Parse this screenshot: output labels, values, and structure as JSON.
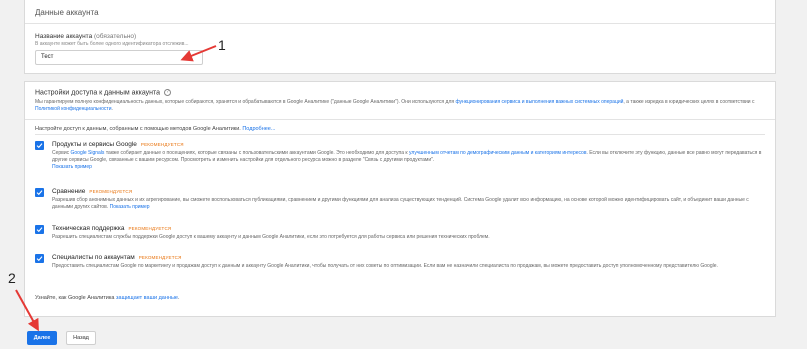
{
  "account_card": {
    "title": "Данные аккаунта",
    "name_label": "Название аккаунта",
    "name_optional": "(обязательно)",
    "name_hint": "В аккаунте может быть более одного идентификатора отслежив...",
    "name_value": "Тест"
  },
  "access_card": {
    "title": "Настройки доступа к данным аккаунта",
    "intro_1": "Мы гарантируем полную конфиденциальность данных, которые собираются, хранятся и обрабатываются в Google Аналитике (\"данные Google Аналитики\"). Они используются для ",
    "intro_link_1": "функционирования сервиса и выполнения важных системных операций",
    "intro_2": ", а также изредка в юридических целях в соответствии с ",
    "intro_link_2": "Политикой конфиденциальности",
    "intro_3": ".",
    "configure_text": "Настройте доступ к данным, собранным с помощью методов Google Аналитики.",
    "configure_link": "Подробнее...",
    "recommended": "РЕКОМЕНДУЕТСЯ",
    "options": [
      {
        "title": "Продукты и сервисы Google",
        "desc_1": "Сервис ",
        "desc_link_1": "Google Signals",
        "desc_2": " также собирает данные о посещениях, которые связаны с пользовательскими аккаунтами Google. Это необходимо для доступа к ",
        "desc_link_2": "улучшенным отчетам по демографическим данным и категориям интересов",
        "desc_3": ". Если вы отключите эту функцию, данные все равно могут передаваться в другие сервисы Google, связанные с вашим ресурсом. Просмотреть и изменить настройки для отдельного ресурса можно в разделе \"Связь с другими продуктами\".",
        "show_example": "Показать пример",
        "checked": true
      },
      {
        "title": "Сравнение",
        "desc": "Разрешив сбор анонимных данных и их агрегирование, вы сможете воспользоваться публикациями, сравнением и другими функциями для анализа существующих тенденций. Система Google удалит всю информацию, на основе которой можно идентифицировать сайт, и объединит ваши данные с данными других сайтов.",
        "show_example": "Показать пример",
        "checked": true
      },
      {
        "title": "Техническая поддержка",
        "desc": "Разрешить специалистам службы поддержки Google доступ к вашему аккаунту и данным Google Аналитики, если это потребуется для работы сервиса или решения технических проблем.",
        "checked": true
      },
      {
        "title": "Специалисты по аккаунтам",
        "desc": "Предоставить специалистам Google по маркетингу и продажам доступ к данным и аккаунту Google Аналитики, чтобы получать от них советы по оптимизации. Если вам не назначили специалиста по продажам, вы можете предоставить доступ уполномоченному представителю Google.",
        "checked": true
      }
    ],
    "footer_text": "Узнайте, как Google Аналитика ",
    "footer_link": "защищает ваши данные",
    "footer_end": "."
  },
  "buttons": {
    "next": "Далее",
    "back": "Назад"
  },
  "annotations": {
    "marker_1": "1",
    "marker_2": "2",
    "arrow_color": "#e53935"
  },
  "colors": {
    "accent": "#1a73e8",
    "recommended": "#e8710a"
  }
}
